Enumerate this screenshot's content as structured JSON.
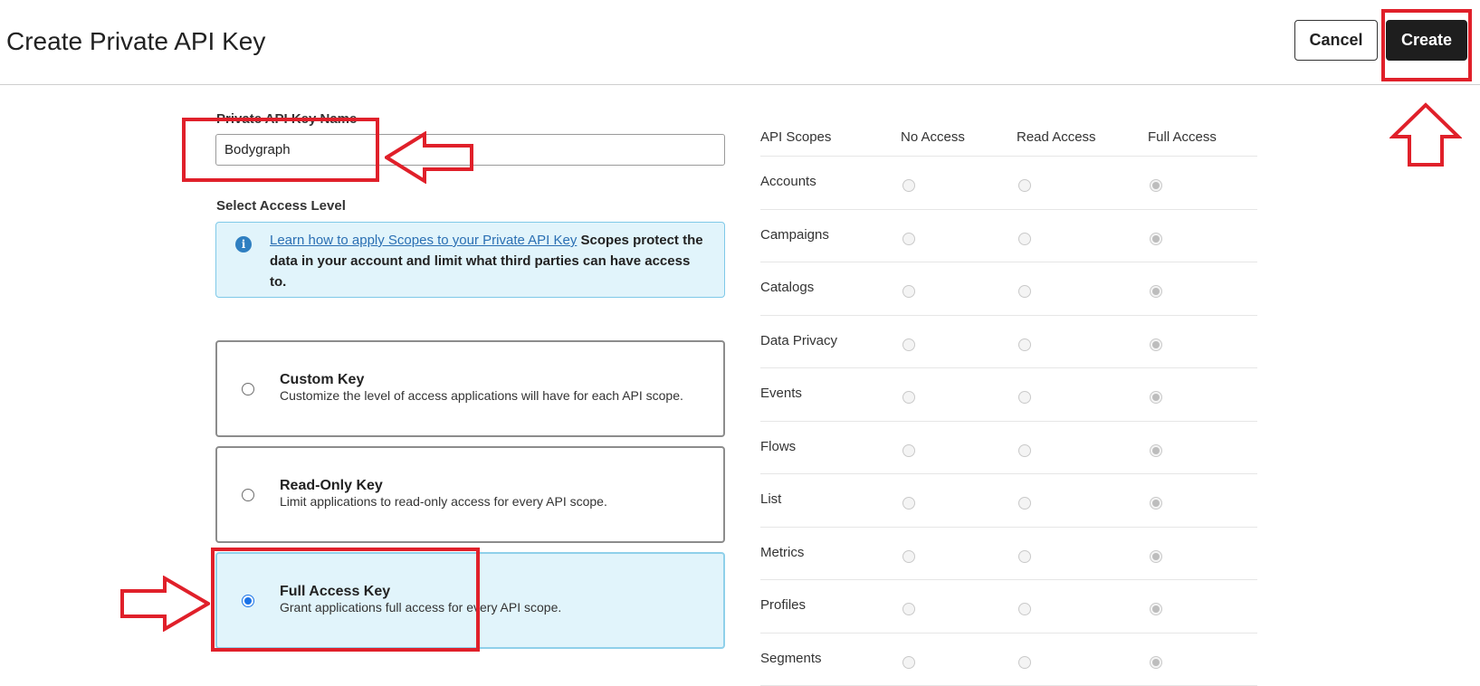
{
  "header": {
    "title": "Create Private API Key",
    "cancel_label": "Cancel",
    "create_label": "Create"
  },
  "form": {
    "name_label": "Private API Key Name",
    "name_value": "Bodygraph",
    "access_label": "Select Access Level",
    "info": {
      "link_text": "Learn how to apply Scopes to your Private API Key",
      "text": " Scopes protect the data in your account and limit what third parties can have access to."
    },
    "key_types": [
      {
        "title": "Custom Key",
        "description": "Customize the level of access applications will have for each API scope.",
        "selected": false
      },
      {
        "title": "Read-Only Key",
        "description": "Limit applications to read-only access for every API scope.",
        "selected": false
      },
      {
        "title": "Full Access Key",
        "description": "Grant applications full access for every API scope.",
        "selected": true
      }
    ]
  },
  "scopes": {
    "headers": {
      "scope": "API Scopes",
      "none": "No Access",
      "read": "Read Access",
      "full": "Full Access"
    },
    "rows": [
      {
        "name": "Accounts",
        "access": "full"
      },
      {
        "name": "Campaigns",
        "access": "full"
      },
      {
        "name": "Catalogs",
        "access": "full"
      },
      {
        "name": "Data Privacy",
        "access": "full"
      },
      {
        "name": "Events",
        "access": "full"
      },
      {
        "name": "Flows",
        "access": "full"
      },
      {
        "name": "List",
        "access": "full"
      },
      {
        "name": "Metrics",
        "access": "full"
      },
      {
        "name": "Profiles",
        "access": "full"
      },
      {
        "name": "Segments",
        "access": "full"
      }
    ]
  },
  "annotation_color": "#e0202a"
}
